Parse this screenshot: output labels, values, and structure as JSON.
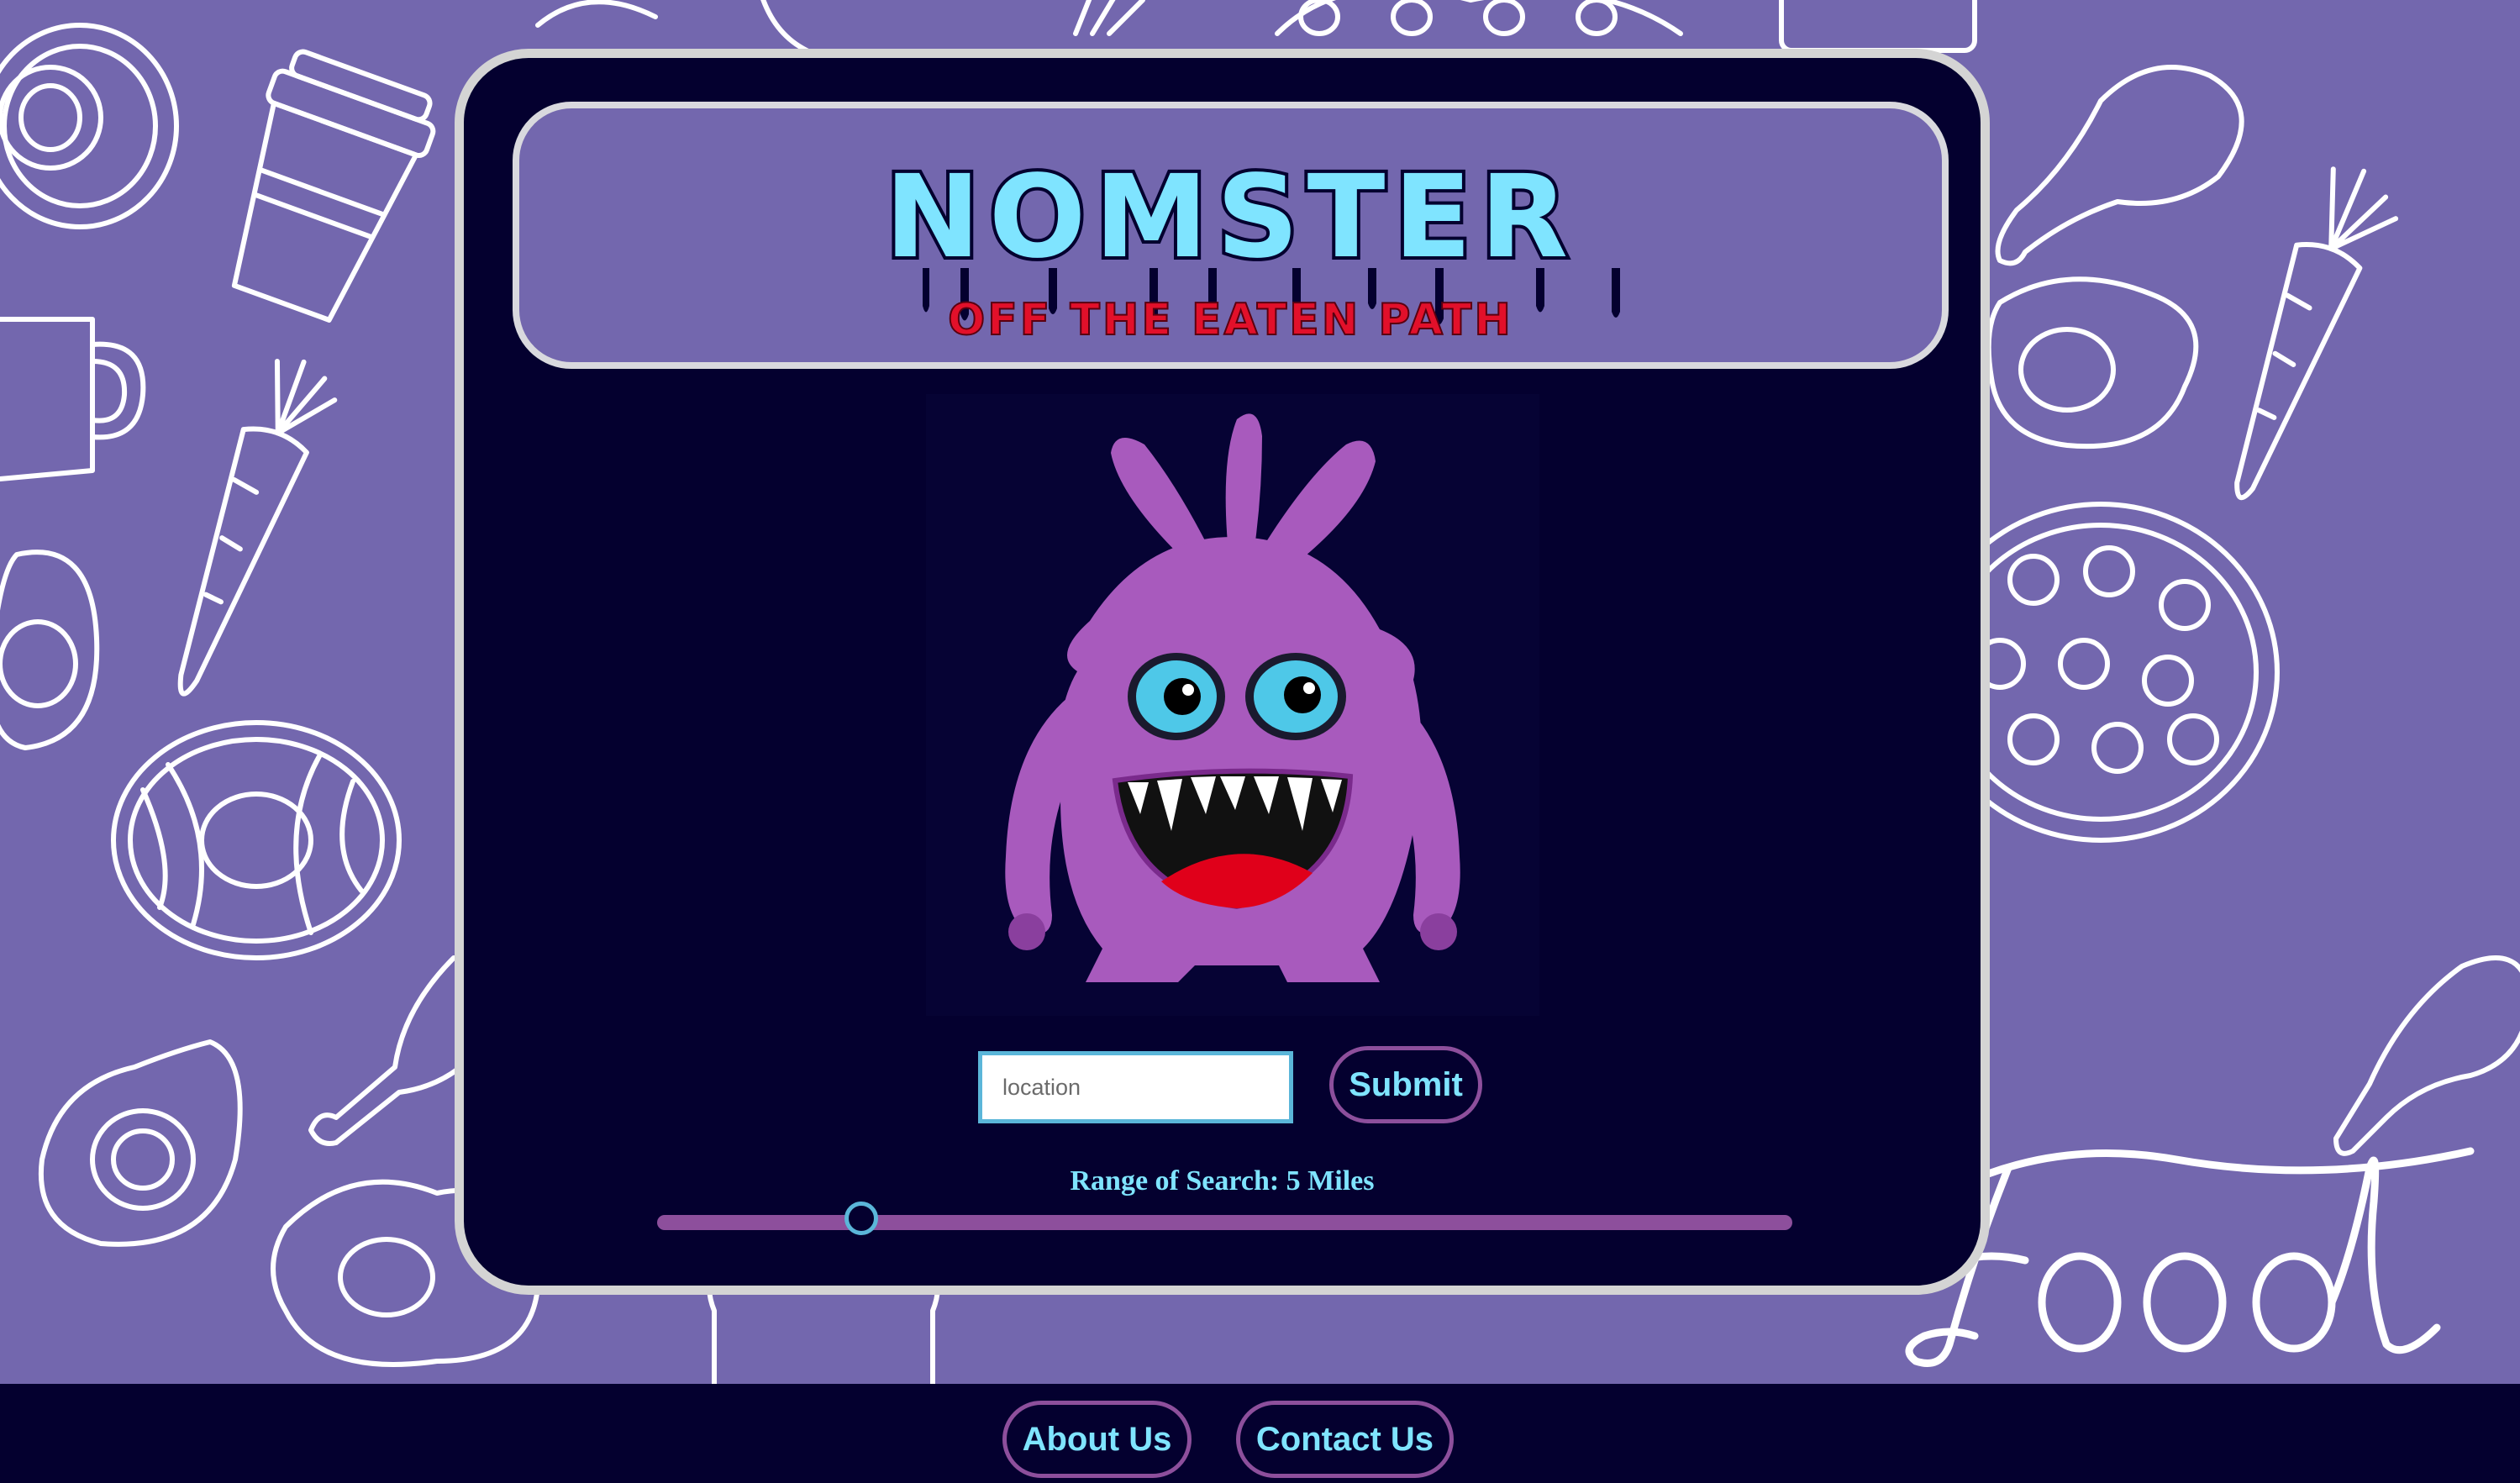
{
  "background": {
    "color": "#7367ae",
    "doodle_color": "#ffffff",
    "script_text": "Food"
  },
  "header": {
    "title": "NOMSTER",
    "tagline": "OFF THE EATEN PATH",
    "title_color": "#7fe4ff",
    "tagline_color": "#e2102a"
  },
  "mascot": {
    "icon": "purple-monster-icon",
    "body_color": "#a85abd"
  },
  "search": {
    "placeholder": "location",
    "value": "",
    "submit_label": "Submit"
  },
  "range": {
    "label": "Range of Search: 5 Miles",
    "value_miles": 5,
    "fraction": 0.18
  },
  "footer": {
    "about_label": "About Us",
    "contact_label": "Contact Us"
  },
  "colors": {
    "card_bg": "#04002f",
    "accent_cyan": "#7fe4ff",
    "accent_purple": "#8d4f9c"
  }
}
